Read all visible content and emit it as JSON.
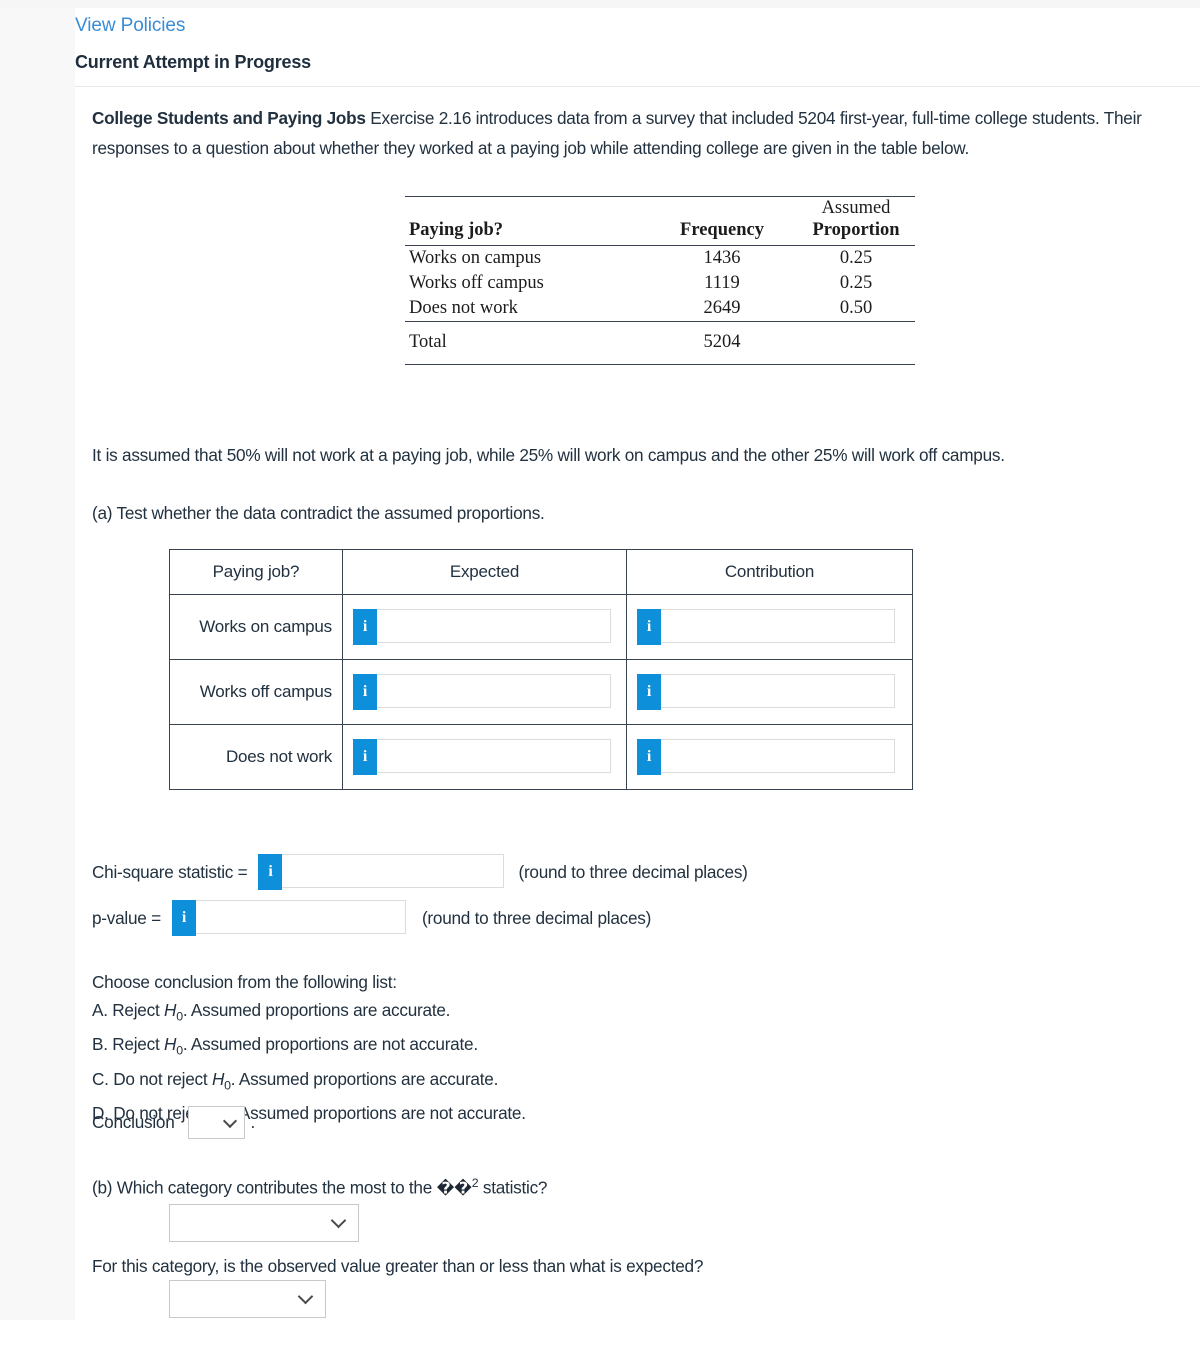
{
  "header": {
    "view_policies": "View Policies",
    "attempt_status": "Current Attempt in Progress"
  },
  "intro": {
    "bold_title": "College Students and Paying Jobs",
    "body": " Exercise 2.16 introduces data from a survey that included 5204 first-year, full-time college students. Their responses to a question about whether they worked at a paying job while attending college are given in the table below."
  },
  "stats_table": {
    "headers": {
      "category": "Paying job?",
      "frequency": "Frequency",
      "assumed_proportion_line1": "Assumed",
      "assumed_proportion_line2": "Proportion"
    },
    "rows": [
      {
        "category": "Works on campus",
        "frequency": "1436",
        "proportion": "0.25"
      },
      {
        "category": "Works off campus",
        "frequency": "1119",
        "proportion": "0.25"
      },
      {
        "category": "Does not work",
        "frequency": "2649",
        "proportion": "0.50"
      }
    ],
    "total": {
      "label": "Total",
      "frequency": "5204",
      "proportion": ""
    }
  },
  "assumption_text": "It is assumed that 50% will not work at a paying job, while 25% will work on campus and the other 25% will work off campus.",
  "part_a": {
    "prompt": "(a) Test whether the data contradict the assumed proportions.",
    "table_headers": {
      "category": "Paying job?",
      "expected": "Expected",
      "contribution": "Contribution"
    },
    "rows": [
      {
        "category": "Works on campus",
        "expected_value": "",
        "contribution_value": ""
      },
      {
        "category": "Works off campus",
        "expected_value": "",
        "contribution_value": ""
      },
      {
        "category": "Does not work",
        "expected_value": "",
        "contribution_value": ""
      }
    ],
    "info_icon_label": "i",
    "chi_square": {
      "label": "Chi-square statistic =",
      "value": "",
      "note": "(round to three decimal places)"
    },
    "p_value": {
      "label": "p-value =",
      "value": "",
      "note": "(round to three decimal places)"
    },
    "conclusion": {
      "intro": "Choose conclusion from the following list:",
      "options": [
        {
          "letter": "A. Reject ",
          "h": "H",
          "sub": "0",
          "rest": ". Assumed proportions are accurate."
        },
        {
          "letter": "B. Reject ",
          "h": "H",
          "sub": "0",
          "rest": ". Assumed proportions are not accurate."
        },
        {
          "letter": "C. Do not reject ",
          "h": "H",
          "sub": "0",
          "rest": ". Assumed proportions are accurate."
        },
        {
          "letter": "D. Do not reject ",
          "h": "H",
          "sub": "0",
          "rest": ". Assumed proportions are not accurate."
        }
      ],
      "select_label": "Conclusion",
      "selected_value": "",
      "trailing_period": "."
    }
  },
  "part_b": {
    "prompt_before": "(b) Which category contributes the most to the ",
    "symbol_glyphs": "��",
    "symbol_superscript": "2",
    "prompt_after": " statistic?",
    "category_select_value": "",
    "followup_prompt": "For this category, is the observed value greater than or less than what is expected?",
    "direction_select_value": ""
  },
  "colors": {
    "link_blue": "#3a8cd6",
    "info_button_blue": "#0d8fd9",
    "text": "#22313f",
    "table_rule": "#3b4354",
    "answer_table_border": "#3a4450",
    "rail_gray": "#f8f8f8"
  }
}
